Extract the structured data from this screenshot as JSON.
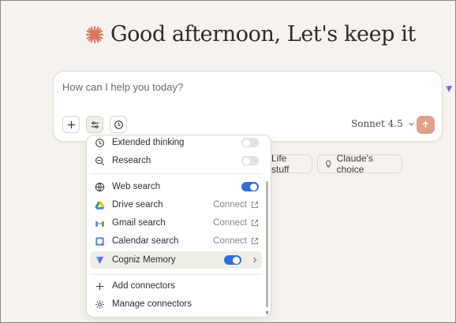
{
  "greeting": {
    "text": "Good afternoon, Let's keep it"
  },
  "composer": {
    "placeholder": "How can I help you today?",
    "model": "Sonnet 4.5"
  },
  "chips": [
    {
      "label": "Life stuff"
    },
    {
      "label": "Claude's choice"
    }
  ],
  "menu": {
    "items": [
      {
        "label": "Extended thinking",
        "icon": "clock-icon",
        "toggle": "off"
      },
      {
        "label": "Research",
        "icon": "research-icon",
        "toggle": "off"
      },
      {
        "label": "Web search",
        "icon": "globe-icon",
        "toggle": "on"
      },
      {
        "label": "Drive search",
        "icon": "google-drive-icon",
        "action": "Connect"
      },
      {
        "label": "Gmail search",
        "icon": "gmail-icon",
        "action": "Connect"
      },
      {
        "label": "Calendar search",
        "icon": "google-calendar-icon",
        "action": "Connect"
      },
      {
        "label": "Cogniz Memory",
        "icon": "cogniz-icon",
        "toggle": "on"
      },
      {
        "label": "Add connectors",
        "icon": "plus-icon"
      },
      {
        "label": "Manage connectors",
        "icon": "gear-icon"
      }
    ]
  },
  "colors": {
    "accent": "#d97757",
    "toggle_on": "#2f6fd6",
    "send": "#e0a08b"
  }
}
